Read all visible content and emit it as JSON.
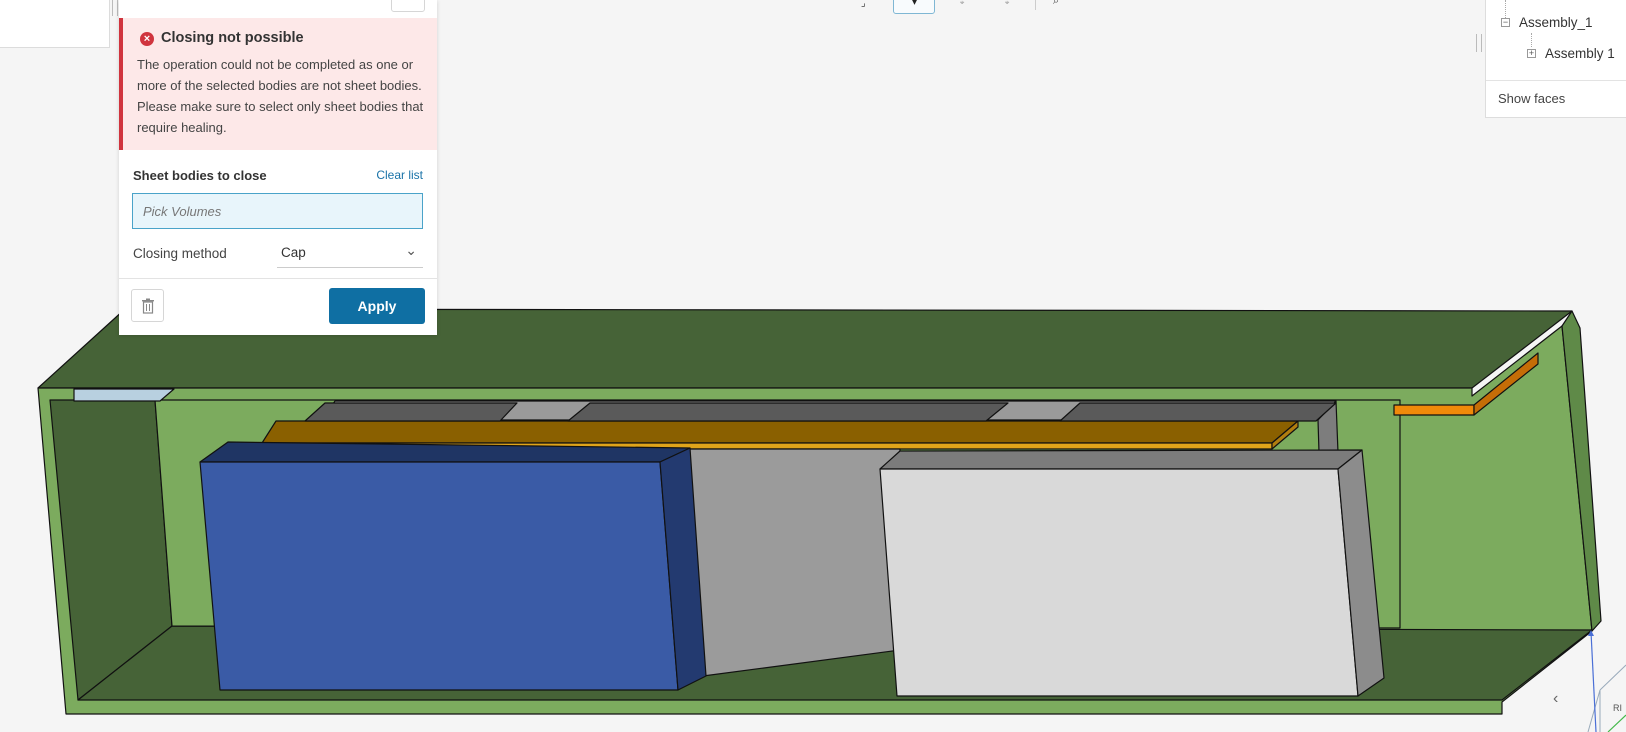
{
  "error": {
    "title": "Closing not possible",
    "message": "The operation could not be completed as one or more of the selected bodies are not sheet bodies. Please make sure to select only sheet bodies that require healing."
  },
  "form": {
    "section_label": "Sheet bodies to close",
    "clear_label": "Clear list",
    "pick_placeholder": "Pick Volumes",
    "method_label": "Closing method",
    "method_value": "Cap",
    "apply_label": "Apply"
  },
  "tree": {
    "root_label": "Assembly_1",
    "child_label": "Assembly 1",
    "show_faces_label": "Show faces"
  },
  "viewcube": {
    "label_fragment": "RI"
  },
  "icons": {
    "error": "error-circle-icon",
    "trash": "trash-icon",
    "chevron": "chevron-down-icon",
    "collapse": "chevron-left-icon"
  },
  "colors": {
    "error_accent": "#d0343e",
    "error_bg": "#fde8e8",
    "primary": "#0f6fa3",
    "link": "#1a73a8",
    "input_border": "#4aa3c9",
    "enclosure_green": "#7cab5e",
    "enclosure_dark": "#466337",
    "blue_body": "#3a5ba6",
    "light_body": "#d9d9d9",
    "pcb_gold": "#e0a41a",
    "orange_part": "#f08a0a"
  }
}
